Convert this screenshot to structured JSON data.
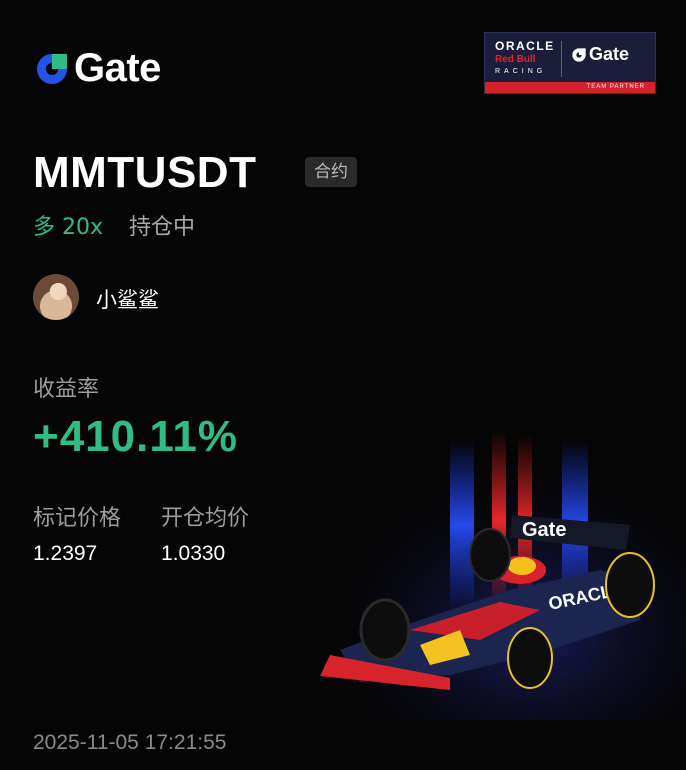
{
  "brand": {
    "name": "Gate"
  },
  "partner_badge": {
    "oracle": "ORACLE",
    "redbull": "Red Bull",
    "racing": "RACING",
    "gate": "Gate",
    "footer": "TEAM PARTNER"
  },
  "position": {
    "symbol": "MMTUSDT",
    "type_tag": "合约",
    "side_leverage": "多 20x",
    "status": "持仓中"
  },
  "user": {
    "name": "小鲨鲨"
  },
  "roi": {
    "label": "收益率",
    "value": "+410.11%"
  },
  "metrics": [
    {
      "label": "标记价格",
      "value": "1.2397"
    },
    {
      "label": "开仓均价",
      "value": "1.0330"
    }
  ],
  "timestamp": "2025-11-05 17:21:55",
  "car_livery": {
    "car_text": "ORACLE",
    "wing_text": "Gate"
  },
  "colors": {
    "background": "#050505",
    "accent_green": "#2fbd85",
    "brand_blue": "#2354e6",
    "muted_text": "#9d9d9d",
    "partner_bg": "#1b1e3a",
    "partner_red": "#d6202a"
  }
}
